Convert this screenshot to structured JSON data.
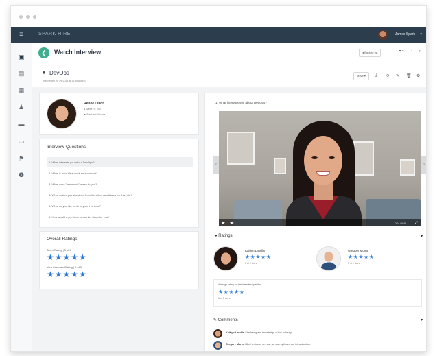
{
  "topbar": {
    "brand": "SPARK HIRE",
    "user_name": "James Spark",
    "user_caret": "▾"
  },
  "titlebar": {
    "title": "Watch Interview",
    "back_button_label": "◂ Back to list",
    "nav_prev": "‹",
    "nav_next": "›",
    "nav_filter": "⏷▾"
  },
  "job": {
    "title": "DevOps",
    "subtitle": "Interviewed on 3/6/2014 at 10:35 AM EST",
    "move_select": "Move ▾"
  },
  "candidate": {
    "name": "Renee Dillon",
    "location": "● Santa Fe, NM",
    "link": "☛ Send email to me"
  },
  "questions": {
    "title": "Interview Questions",
    "items": [
      "1. What interests you about DevOps?",
      "2. What is your ideal work environment?",
      "3. What does \"teamwork\" mean to you?",
      "4. What makes you stand out from the other candidates for this role?",
      "5. What do you like to do in your free time?",
      "6. How would a previous co-worker describe you?"
    ]
  },
  "overall": {
    "title": "Overall Ratings",
    "team_label": "Team Rating | 5 of 5",
    "your_label": "Your Interview Rating | 5 of 5",
    "stars": "★★★★★"
  },
  "video": {
    "question": "1. What interests you about DevOps?",
    "time": "0:04 / 0:45",
    "play": "▶",
    "volume": "◀)",
    "fullscreen": "⤢"
  },
  "ratings": {
    "title": "Ratings",
    "caret": "▾",
    "raters": [
      {
        "name": "Kaitlyn Landlin",
        "stars": "★★★★★",
        "sub": "5 of 5 stars"
      },
      {
        "name": "Gregory Morro",
        "stars": "★★★★★",
        "sub": "5 of 5 stars"
      }
    ],
    "average_label": "Average rating for this interview question",
    "average_stars": "★★★★★",
    "average_sub": "5 of 5 stars"
  },
  "comments": {
    "title": "Comments",
    "caret": "▾",
    "items": [
      {
        "author": "Kaitlyn Landlin",
        "text": "She has great knowledge of the industry."
      },
      {
        "author": "Gregory Morro",
        "text": "I like her ideas on how we can optimize our infrastructure."
      }
    ]
  },
  "colors": {
    "topbar": "#2c3e4e",
    "accent_green": "#3fae8e",
    "star_blue": "#2f7bd3"
  },
  "icons": {
    "menu": "≡",
    "sidebar": [
      "▣",
      "▤",
      "▦",
      "♟",
      "▬",
      "▭",
      "⚑",
      "❶"
    ],
    "toolbar": [
      "⤓",
      "⟲",
      "✎",
      "🗑",
      "⚙"
    ]
  }
}
